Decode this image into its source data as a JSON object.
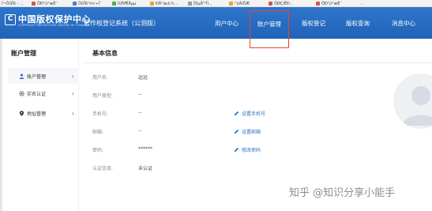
{
  "bookmarks": [
    "Í¬ÔÚÏß - ...",
    "ÖÐ¹ú°æÈ¨",
    "ÔÚÏß¹¤×÷Ì¨",
    "ÌÚÑ¶ÎÄµµ",
    "ÐÂ°æ±¾...",
    "ÎÒµÄ¹²Ïí...",
    "°¢ÀïÔÆ",
    "ÖØÇìÊÐ...",
    "ÖÐ¹ú°æÈ¨",
    "..."
  ],
  "header": {
    "logo_badge": "C",
    "logo_main": "中国版权保护中心",
    "logo_sub": "COPYRIGHT PROTECTION CENTER OF CHINA",
    "system_name": "著作权登记系统（公测版）",
    "nav": {
      "user_center": "用户中心",
      "account": "账户管理",
      "copyright_reg": "版权登记",
      "copyright_query": "版权查询",
      "messages": "消息中心"
    }
  },
  "sidebar": {
    "title": "账户管理",
    "items": [
      {
        "label": "账户管理",
        "icon": "user-icon",
        "active": true
      },
      {
        "label": "实名认证",
        "icon": "gear-icon",
        "active": false
      },
      {
        "label": "地址管理",
        "icon": "location-pin-icon",
        "active": false
      }
    ]
  },
  "main": {
    "title": "基本信息",
    "fields": {
      "username": {
        "label": "用户名:",
        "value": "远远"
      },
      "user_type": {
        "label": "用户类型:",
        "value": "--"
      },
      "phone": {
        "label": "手机号:",
        "value": "--",
        "action": "设置手机号"
      },
      "email": {
        "label": "邮箱:",
        "value": "--",
        "action": "设置邮箱"
      },
      "password": {
        "label": "密码:",
        "value": "******",
        "action": "修改密码"
      },
      "verify": {
        "label": "认证信息:",
        "value": "未认证"
      }
    }
  },
  "watermark": "知乎 @知识分享小能手",
  "colors": {
    "header": "#1f63b8",
    "active_outline": "#e8452a",
    "link": "#2f6fc4"
  }
}
